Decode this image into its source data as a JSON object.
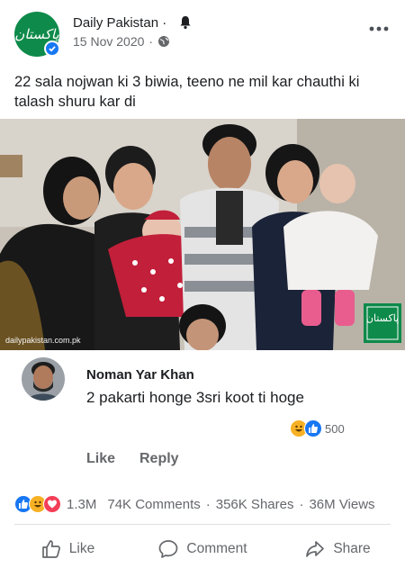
{
  "post": {
    "page_name": "Daily Pakistan",
    "name_separator": "·",
    "date": "15 Nov 2020",
    "date_separator": "·",
    "caption": "22 sala nojwan ki 3 biwia, teeno ne mil kar chauthi ki talash shuru kar di",
    "avatar_text": "پاکستان",
    "icons": [
      "bell-icon",
      "globe-icon",
      "more-icon",
      "verified-badge-icon"
    ]
  },
  "photo": {
    "watermark": "dailypakistan.com.pk",
    "logo_text": "پاکستان"
  },
  "comment": {
    "author": "Noman Yar Khan",
    "text": "2 pakarti honge 3sri koot ti hoge",
    "reaction_count": "500",
    "like_label": "Like",
    "reply_label": "Reply"
  },
  "stats": {
    "reactions": "1.3M",
    "comments": "74K Comments",
    "shares": "356K Shares",
    "views": "36M Views",
    "separator": "·"
  },
  "actions": {
    "like": "Like",
    "comment": "Comment",
    "share": "Share"
  },
  "colors": {
    "brand_green": "#0e8a4a",
    "like_blue": "#1877f2",
    "love_red": "#f33e58",
    "haha_yellow": "#f7b125",
    "muted_text": "#65676b"
  }
}
